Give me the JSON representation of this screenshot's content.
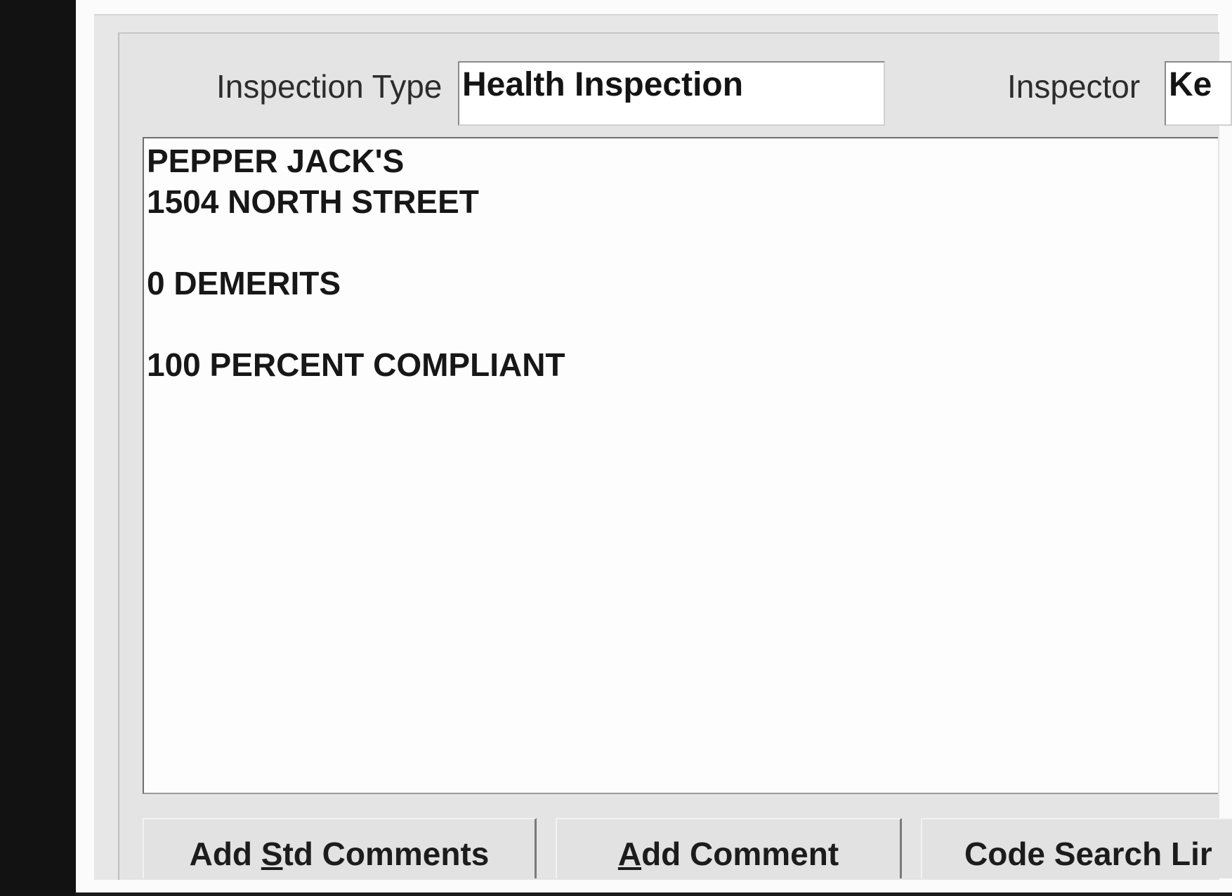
{
  "form": {
    "inspection_type_label": "Inspection Type",
    "inspection_type_value": "Health Inspection",
    "inspector_label": "Inspector",
    "inspector_value": "Ke"
  },
  "comments": {
    "lines": [
      "PEPPER JACK'S",
      "1504 NORTH STREET",
      "",
      "0 DEMERITS",
      "",
      "100 PERCENT COMPLIANT"
    ]
  },
  "buttons": {
    "add_std_comments": {
      "pre": "Add ",
      "accel": "S",
      "post": "td Comments"
    },
    "add_comment": {
      "pre": "",
      "accel": "A",
      "post": "dd Comment"
    },
    "code_search": {
      "label": "Code Search Lir"
    }
  }
}
